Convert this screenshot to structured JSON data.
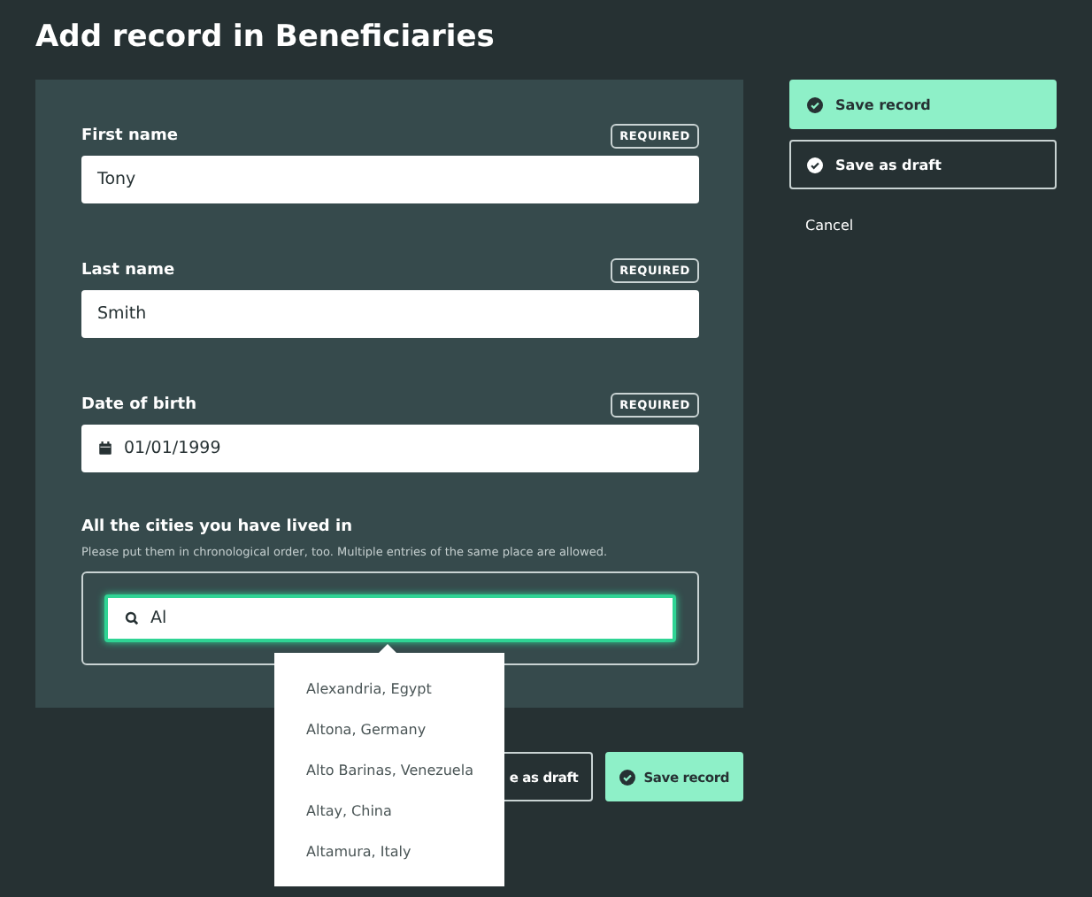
{
  "title": "Add record in Beneficiaries",
  "fields": [
    {
      "kind": "text",
      "label": "First name",
      "required": true,
      "badge": "REQUIRED",
      "value": "Tony"
    },
    {
      "kind": "text",
      "label": "Last name",
      "required": true,
      "badge": "REQUIRED",
      "value": "Smith"
    },
    {
      "kind": "date",
      "label": "Date of birth",
      "required": true,
      "badge": "REQUIRED",
      "value": "01/01/1999"
    },
    {
      "kind": "search",
      "label": "All the cities you have lived in",
      "help": "Please put them in chronological order, too. Multiple entries of the same place are allowed.",
      "value": "Al"
    }
  ],
  "suggestions": [
    "Alexandria, Egypt",
    "Altona, Germany",
    "Alto Barinas, Venezuela",
    "Altay, China",
    "Altamura, Italy"
  ],
  "side_actions": [
    {
      "kind": "primary",
      "label": "Save record"
    },
    {
      "kind": "secondary",
      "label": "Save as draft"
    },
    {
      "kind": "link",
      "label": "Cancel"
    }
  ],
  "bottom_actions": [
    {
      "kind": "secondary",
      "label": "e as draft"
    },
    {
      "kind": "primary",
      "label": "Save record"
    }
  ]
}
